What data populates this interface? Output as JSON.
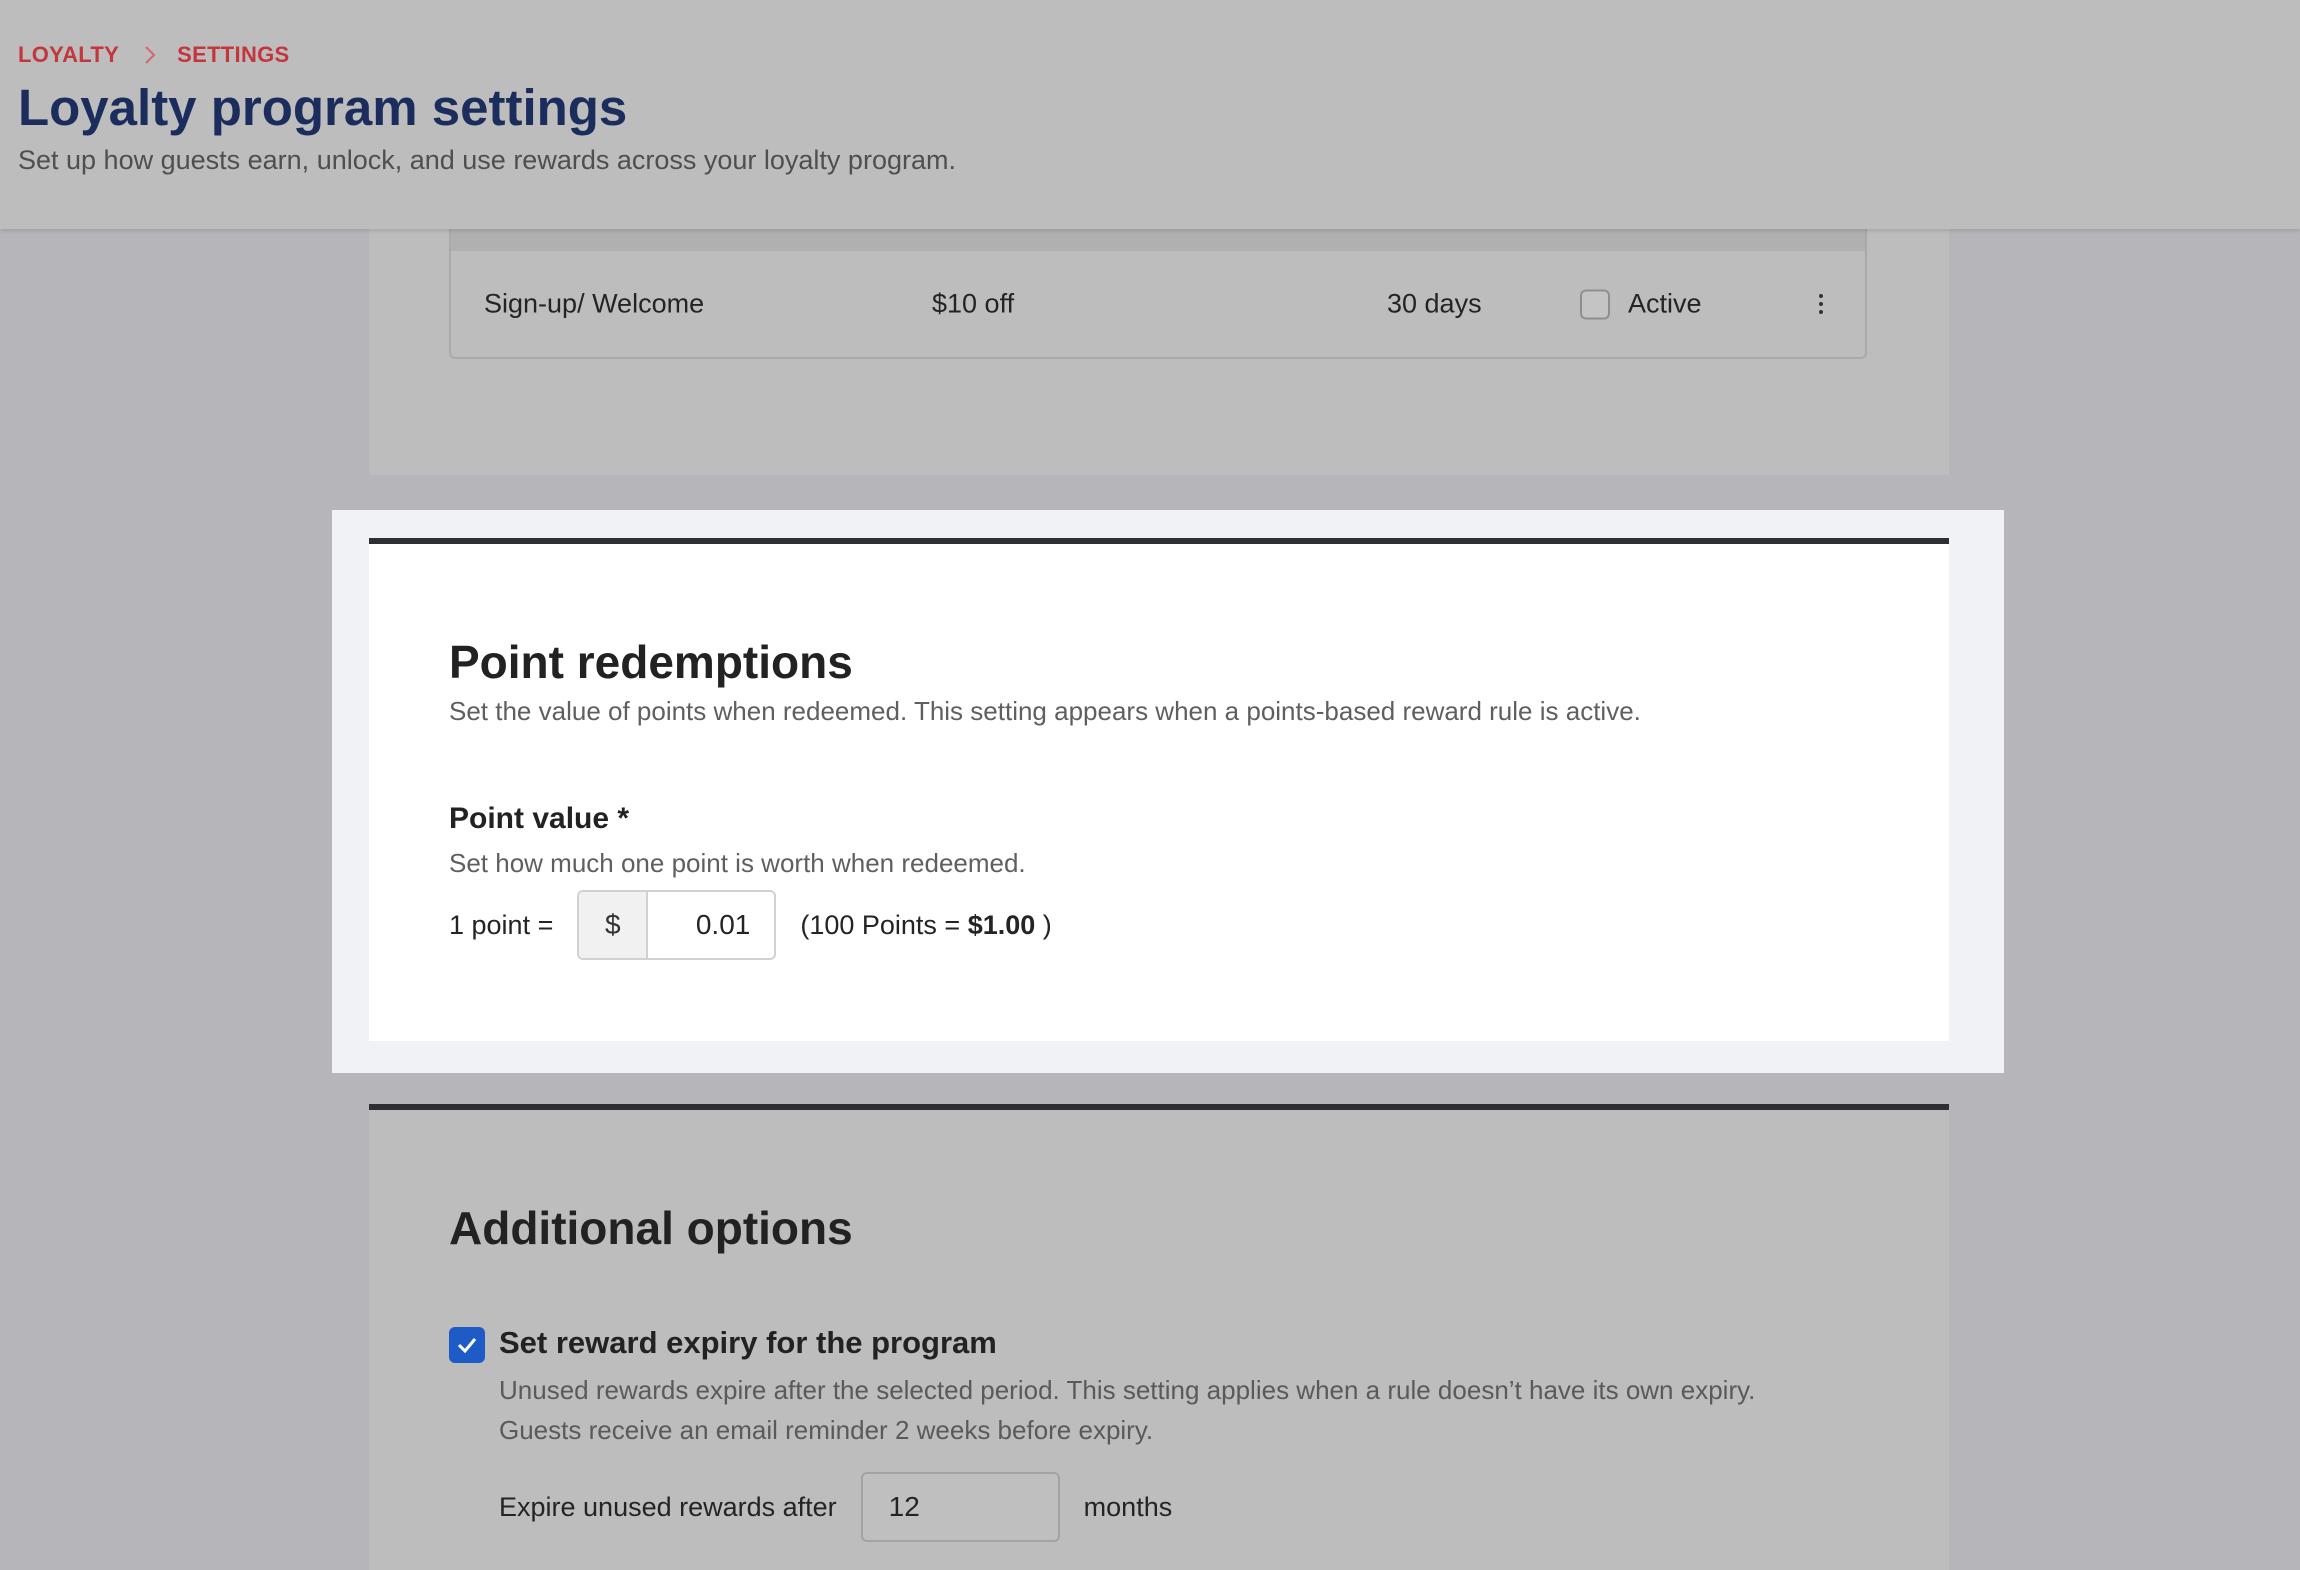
{
  "header": {
    "breadcrumb": [
      "LOYALTY",
      "SETTINGS"
    ],
    "title": "Loyalty program settings",
    "subtitle": "Set up how guests earn, unlock, and use rewards across your loyalty program."
  },
  "rules_table": {
    "rows": [
      {
        "name": "Sign-up/ Welcome",
        "reward": "$10 off",
        "expiry": "30 days",
        "status_label": "Active",
        "active": false
      }
    ]
  },
  "point_redemptions": {
    "title": "Point redemptions",
    "description": "Set the value of points when redeemed. This setting appears when a points-based reward rule is active.",
    "point_value_label": "Point value *",
    "point_value_help": "Set how much one point is worth when redeemed.",
    "row_prefix": "1 point =",
    "currency_symbol": "$",
    "value": "0.01",
    "equivalence_prefix": "(100 Points = ",
    "equivalence_amount": "$1.00",
    "equivalence_suffix": " )"
  },
  "additional_options": {
    "title": "Additional options",
    "reward_expiry": {
      "checked": true,
      "label": "Set reward expiry for the program",
      "description_line1": "Unused rewards expire after the selected period. This setting applies when a rule doesn’t have its own expiry.",
      "description_line2": "Guests receive an email reminder 2 weeks before expiry.",
      "expire_prefix": "Expire unused rewards after",
      "expire_value": "12",
      "expire_unit": "months"
    }
  },
  "colors": {
    "brand_red": "#c4363d",
    "title_navy": "#1b2d5c",
    "checkbox_blue": "#1e5bc6"
  }
}
